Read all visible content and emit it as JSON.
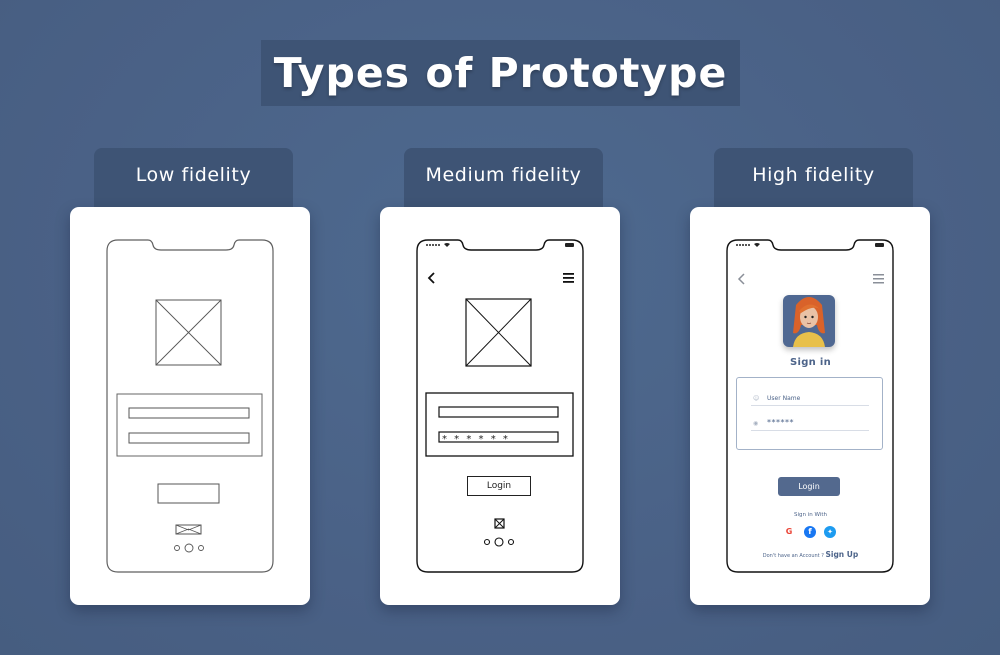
{
  "title": "Types of Prototype",
  "columns": [
    {
      "label": "Low fidelity",
      "style": "sketch",
      "placeholder_image": "image-placeholder-icon",
      "fields": [
        "",
        ""
      ],
      "button_label": "",
      "pager_dots": 3
    },
    {
      "label": "Medium fidelity",
      "style": "wireframe",
      "back_icon": "chevron-left-icon",
      "menu_icon": "hamburger-menu-icon",
      "fields": [
        "",
        "* * * * * *"
      ],
      "button_label": "Login",
      "pager_dots": 3
    },
    {
      "label": "High fidelity",
      "style": "polished",
      "back_icon": "chevron-left-icon",
      "menu_icon": "hamburger-menu-icon",
      "heading": "Sign in",
      "username_placeholder": "User Name",
      "password_value": "******",
      "button_label": "Login",
      "sign_in_with": "Sign in With",
      "social": [
        "google",
        "facebook",
        "twitter"
      ],
      "no_account": "Don't have an Account ?",
      "sign_up": "Sign Up"
    }
  ],
  "colors": {
    "background": "#4a6186",
    "label_box": "#3e5475",
    "accent": "#53698e",
    "text_accent": "#4c6389",
    "google": "#ea4335",
    "facebook": "#1877f2",
    "twitter": "#1d9bf0"
  }
}
